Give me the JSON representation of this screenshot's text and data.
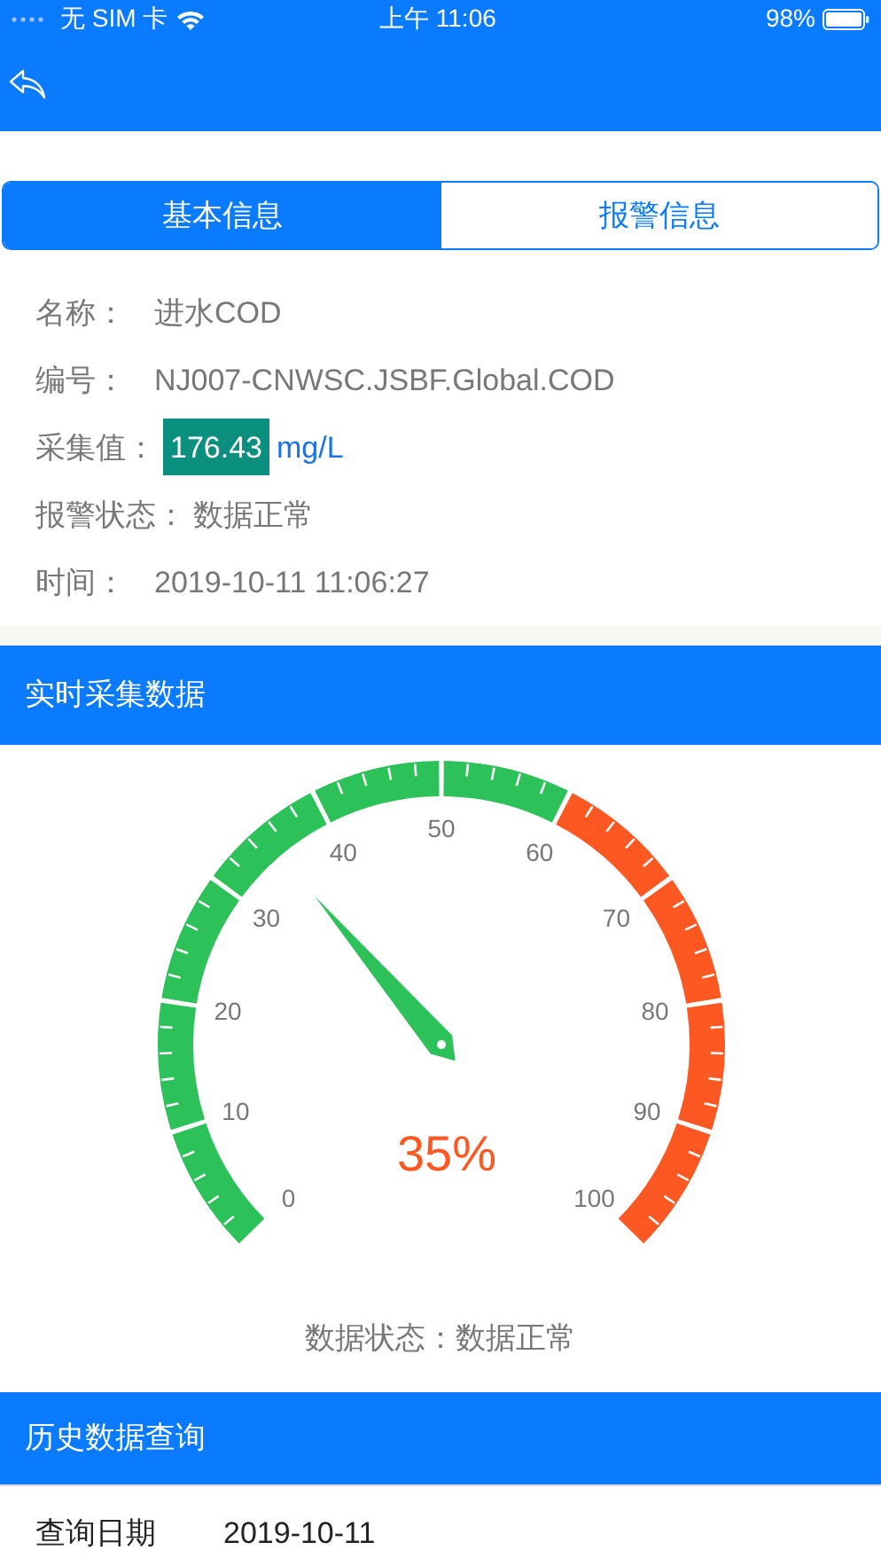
{
  "status_bar": {
    "carrier": "无 SIM 卡",
    "time": "上午 11:06",
    "battery": "98%"
  },
  "tabs": [
    {
      "label": "基本信息",
      "selected": true
    },
    {
      "label": "报警信息",
      "selected": false
    }
  ],
  "info": [
    {
      "kind": "text",
      "label": "名称：",
      "value": "进水COD"
    },
    {
      "kind": "text",
      "label": "编号：",
      "value": "NJ007-CNWSC.JSBF.Global.COD"
    },
    {
      "kind": "measure",
      "label": "采集值：",
      "value": "176.43",
      "unit": "mg/L"
    },
    {
      "kind": "text",
      "label": "报警状态：",
      "value": "数据正常"
    },
    {
      "kind": "text",
      "label": "时间：",
      "value": "2019-10-11 11:06:27"
    }
  ],
  "realtime": {
    "title": "实时采集数据",
    "gauge": {
      "reading": "35%",
      "scale_labels": [
        "0",
        "10",
        "20",
        "30",
        "40",
        "50",
        "60",
        "70",
        "80",
        "90",
        "100"
      ]
    },
    "data_status": "数据状态：数据正常"
  },
  "history": {
    "title": "历史数据查询",
    "rows": [
      {
        "label": "查询日期",
        "value": "2019-10-11"
      }
    ]
  }
}
